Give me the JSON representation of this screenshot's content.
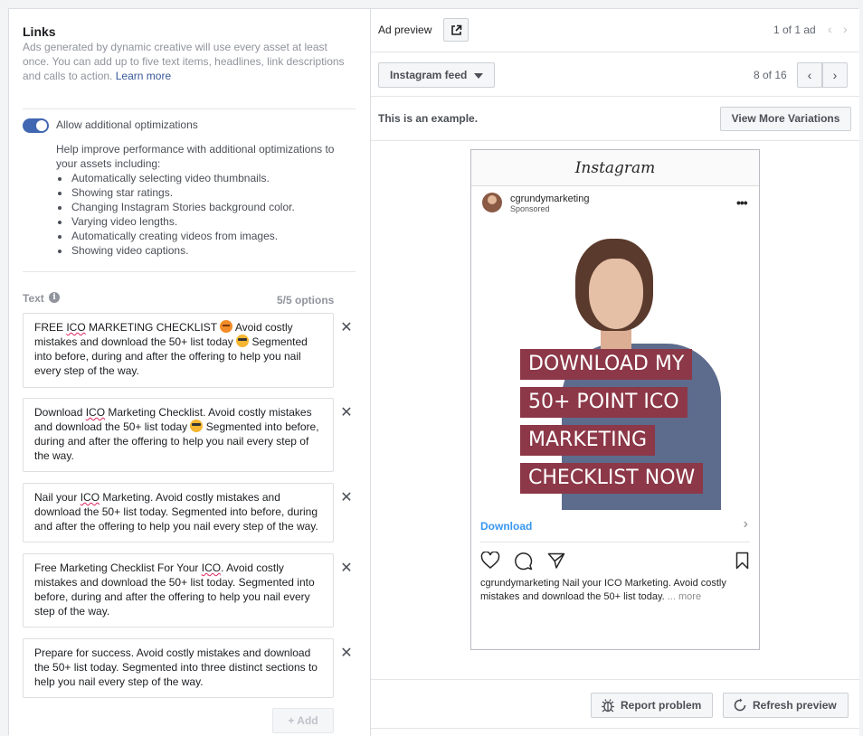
{
  "links": {
    "title": "Links",
    "description": "Ads generated by dynamic creative will use every asset at least once. You can add up to five text items, headlines, link descriptions and calls to action.",
    "learn_more": "Learn more"
  },
  "optimizations": {
    "toggle_on": true,
    "label": "Allow additional optimizations",
    "description": "Help improve performance with additional optimizations to your assets including:",
    "items": [
      "Automatically selecting video thumbnails.",
      "Showing star ratings.",
      "Changing Instagram Stories background color.",
      "Varying video lengths.",
      "Automatically creating videos from images.",
      "Showing video captions."
    ]
  },
  "text_section": {
    "label": "Text",
    "options_count": "5/5 options",
    "items": [
      {
        "pre": "FREE ",
        "sq": "ICO",
        "mid1": " MARKETING CHECKLIST ",
        "mid2": " Avoid costly mistakes and download the 50+ list today ",
        "post": " Segmented into before, during and after the offering to help you nail every step of the way."
      },
      {
        "pre": "Download ",
        "sq": "ICO",
        "mid1": " Marketing Checklist. Avoid costly mistakes and download the 50+ list today ",
        "post": " Segmented into before, during and after the offering to help you nail every step of the way."
      },
      {
        "pre": "Nail your ",
        "sq": "ICO",
        "post": " Marketing. Avoid costly mistakes and download the 50+ list today. Segmented into before, during and after the offering to help you nail every step of the way."
      },
      {
        "pre": "Free Marketing Checklist For Your ",
        "sq": "ICO",
        "post": ". Avoid costly mistakes and download the 50+ list today. Segmented into before, during and after the offering to help you nail every step of the way."
      },
      {
        "text": "Prepare for success. Avoid costly mistakes and download the 50+ list today. Segmented into three distinct sections to help you nail every step of the way."
      }
    ],
    "remove_glyph": "✕",
    "add_label": "+ Add"
  },
  "preview": {
    "label": "Ad preview",
    "ad_count": "1 of 1 ad",
    "placement": "Instagram feed",
    "page_count": "8 of 16",
    "example_text": "This is an example.",
    "variations_button": "View More Variations",
    "ig_logo": "Instagram",
    "account": "cgrundymarketing",
    "sponsored": "Sponsored",
    "headline_lines": [
      "DOWNLOAD MY",
      "50+ POINT ICO",
      "MARKETING",
      "CHECKLIST NOW"
    ],
    "cta": "Download",
    "caption_user": "cgrundymarketing",
    "caption_text": " Nail your ICO Marketing. Avoid costly mistakes and download the 50+ list today. ",
    "caption_more": "... more",
    "report_button": "Report problem",
    "refresh_button": "Refresh preview"
  },
  "colors": {
    "accent": "#4267b2",
    "link": "#385898",
    "headline_bg": "#8c3848",
    "cta": "#3897f0"
  },
  "icons": [
    "external-link-icon",
    "info-icon",
    "close-icon",
    "caret-down-icon",
    "chevron-left-icon",
    "chevron-right-icon",
    "heart-icon",
    "comment-icon",
    "share-icon",
    "bookmark-icon",
    "bug-icon",
    "refresh-icon",
    "more-icon"
  ]
}
